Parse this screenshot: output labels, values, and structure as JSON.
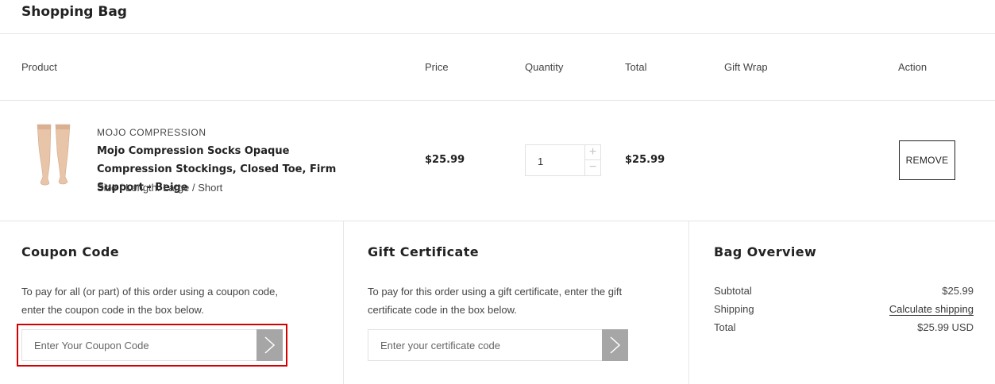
{
  "page_title": "Shopping Bag",
  "table": {
    "headers": {
      "product": "Product",
      "price": "Price",
      "quantity": "Quantity",
      "total": "Total",
      "gift_wrap": "Gift Wrap",
      "action": "Action"
    },
    "rows": [
      {
        "brand": "MOJO COMPRESSION",
        "name": "Mojo Compression Socks  Opaque Compression Stockings, Closed Toe, Firm Support - Beige",
        "variant": "Size / Length: Large / Short",
        "price": "$25.99",
        "quantity": "1",
        "total": "$25.99",
        "remove_label": "REMOVE",
        "image_icon": "compression-socks-image"
      }
    ]
  },
  "coupon": {
    "title": "Coupon Code",
    "description": "To pay for all (or part) of this order using a coupon code, enter the coupon code in the box below.",
    "placeholder": "Enter Your Coupon Code",
    "value": "",
    "submit_icon": "chevron-right-icon"
  },
  "gift_certificate": {
    "title": "Gift Certificate",
    "description": "To pay for this order using a gift certificate, enter the gift certificate code in the box below.",
    "placeholder": "Enter your certificate code",
    "value": "",
    "submit_icon": "chevron-right-icon"
  },
  "overview": {
    "title": "Bag Overview",
    "subtotal_label": "Subtotal",
    "subtotal_value": "$25.99",
    "shipping_label": "Shipping",
    "shipping_link": "Calculate shipping",
    "total_label": "Total",
    "total_value": "$25.99 USD"
  },
  "colors": {
    "highlight": "#d40000",
    "submit_button": "#a6a6a6",
    "divider": "#e6e6e6"
  }
}
